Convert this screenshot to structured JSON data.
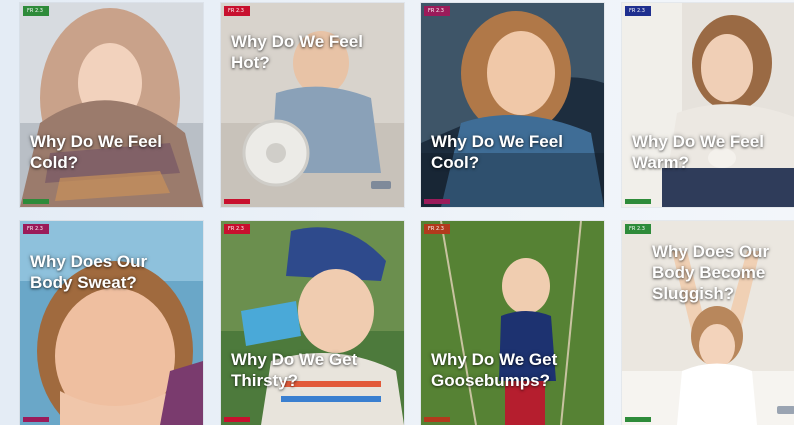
{
  "books": [
    {
      "title": "Why Do We Feel Cold?",
      "level": "FR 2.3",
      "tag_color": "#2e8b3a",
      "footer_color": "#2e8b3a"
    },
    {
      "title": "Why Do We Feel Hot?",
      "level": "FR 2.3",
      "tag_color": "#c8102e",
      "footer_color": "#c8102e"
    },
    {
      "title": "Why Do We Feel Cool?",
      "level": "FR 2.3",
      "tag_color": "#9b1b5a",
      "footer_color": "#9b1b5a"
    },
    {
      "title": "Why Do We Feel Warm?",
      "level": "FR 2.3",
      "tag_color": "#1f2f8f",
      "footer_color": "#2e8b3a"
    },
    {
      "title": "Why Does Our Body Sweat?",
      "level": "FR 2.3",
      "tag_color": "#9b1b5a",
      "footer_color": "#9b1b5a"
    },
    {
      "title": "Why Do We Get Thirsty?",
      "level": "FR 2.3",
      "tag_color": "#c8102e",
      "footer_color": "#c8102e"
    },
    {
      "title": "Why Do We Get Goosebumps?",
      "level": "FR 2.3",
      "tag_color": "#b23a1c",
      "footer_color": "#b23a1c"
    },
    {
      "title": "Why Does Our Body Become Sluggish?",
      "level": "FR 2.3",
      "tag_color": "#2e8b3a",
      "footer_color": "#2e8b3a"
    }
  ]
}
